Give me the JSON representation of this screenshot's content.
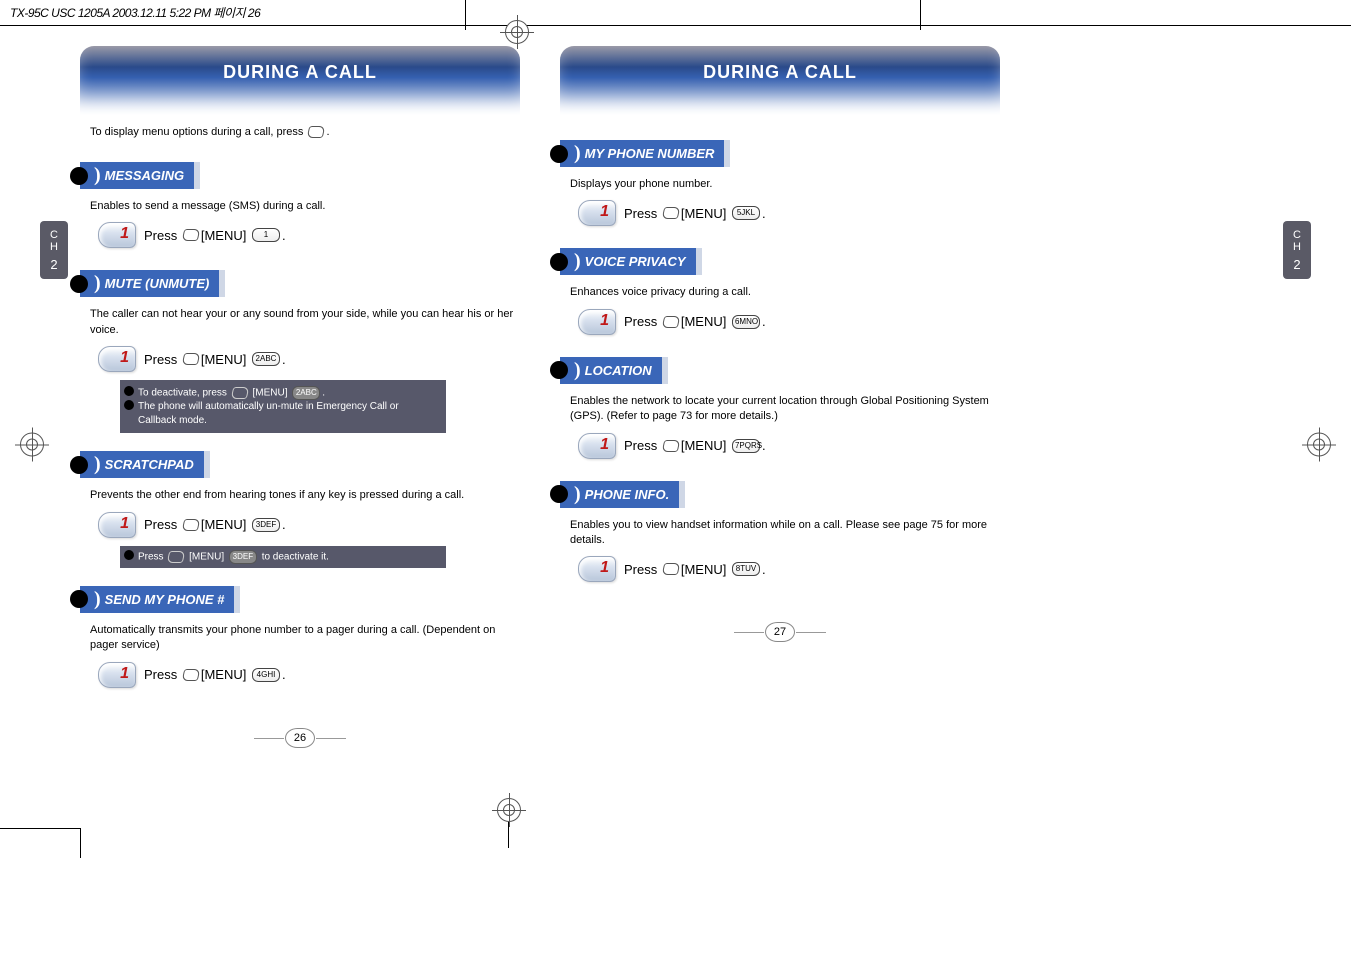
{
  "doc_header": "TX-95C USC 1205A  2003.12.11 5:22 PM  페이지 26",
  "left_page": {
    "title": "DURING A CALL",
    "chapter_label": "C\nH",
    "chapter_num": "2",
    "intro": "To display menu options during a call, press",
    "sections": {
      "messaging": {
        "heading": "MESSAGING",
        "desc": "Enables to send a message (SMS) during a call.",
        "step": "Press",
        "step_menu": "[MENU]",
        "step_key": "1"
      },
      "mute": {
        "heading": "MUTE (UNMUTE)",
        "desc": "The caller can not hear your or any sound from your side, while you can hear his or her voice.",
        "step": "Press",
        "step_menu": "[MENU]",
        "step_key": "2ABC",
        "note1": "To deactivate, press",
        "note1_menu": "[MENU]",
        "note1_key": "2ABC",
        "note2": "The phone will automatically un-mute in Emergency Call or Callback mode."
      },
      "scratchpad": {
        "heading": "SCRATCHPAD",
        "desc": "Prevents the other end from hearing tones if any key is pressed during a call.",
        "step": "Press",
        "step_menu": "[MENU]",
        "step_key": "3DEF",
        "note": "Press",
        "note_menu": "[MENU]",
        "note_key": "3DEF",
        "note_tail": " to deactivate it."
      },
      "sendphone": {
        "heading": "SEND MY PHONE #",
        "desc": "Automatically transmits your phone number to a pager during a call. (Dependent on pager service)",
        "step": "Press",
        "step_menu": "[MENU]",
        "step_key": "4GHI"
      }
    },
    "page_num": "26"
  },
  "right_page": {
    "title": "DURING A CALL",
    "chapter_label": "C\nH",
    "chapter_num": "2",
    "sections": {
      "myphone": {
        "heading": "MY PHONE NUMBER",
        "desc": "Displays your phone number.",
        "step": "Press",
        "step_menu": "[MENU]",
        "step_key": "5JKL"
      },
      "voicepriv": {
        "heading": "VOICE PRIVACY",
        "desc": "Enhances voice privacy during a call.",
        "step": "Press",
        "step_menu": "[MENU]",
        "step_key": "6MNO"
      },
      "location": {
        "heading": "LOCATION",
        "desc": "Enables the network to locate your current location through Global Positioning System (GPS). (Refer to page 73 for more details.)",
        "step": "Press",
        "step_menu": "[MENU]",
        "step_key": "7PQRS"
      },
      "phoneinfo": {
        "heading": "PHONE INFO.",
        "desc": "Enables you to view handset information while on a call. Please see page 75 for more details.",
        "step": "Press",
        "step_menu": "[MENU]",
        "step_key": "8TUV"
      }
    },
    "page_num": "27"
  }
}
